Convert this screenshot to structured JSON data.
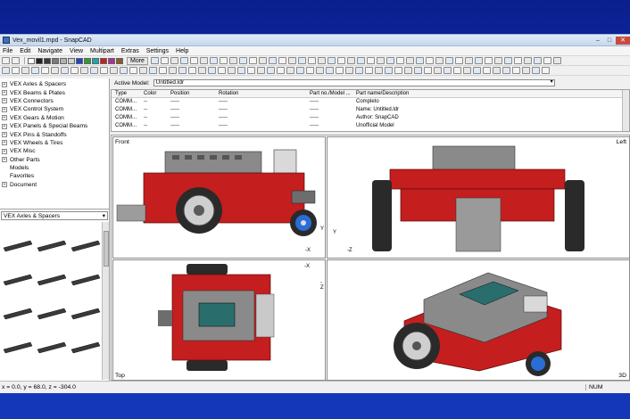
{
  "window": {
    "title": "Vex_movil1.mpd - SnapCAD",
    "minimize": "‒",
    "maximize": "□",
    "close": "✕"
  },
  "menu": [
    "File",
    "Edit",
    "Navigate",
    "View",
    "Multipart",
    "Extras",
    "Settings",
    "Help"
  ],
  "toolbar": {
    "more_label": "More",
    "swatch_colors": [
      "#ffffff",
      "#222222",
      "#3a3a3a",
      "#7a7a7a",
      "#b0b0b0",
      "#d0d0d0",
      "#1e44c8",
      "#2f9b34",
      "#1aa7b0",
      "#c8201e",
      "#b03090",
      "#8a5a2a"
    ]
  },
  "sidebar": {
    "tree": [
      {
        "label": "VEX Axles & Spacers",
        "expandable": true
      },
      {
        "label": "VEX Beams & Plates",
        "expandable": true
      },
      {
        "label": "VEX Connectors",
        "expandable": true
      },
      {
        "label": "VEX Control System",
        "expandable": true
      },
      {
        "label": "VEX Gears & Motion",
        "expandable": true
      },
      {
        "label": "VEX Panels & Special Beams",
        "expandable": true
      },
      {
        "label": "VEX Pins & Standoffs",
        "expandable": true
      },
      {
        "label": "VEX Wheels & Tires",
        "expandable": true
      },
      {
        "label": "VEX Misc",
        "expandable": true
      },
      {
        "label": "Other Parts",
        "expandable": true
      },
      {
        "label": "Models",
        "expandable": false
      },
      {
        "label": "Favorites",
        "expandable": false
      },
      {
        "label": "Document",
        "expandable": true
      }
    ],
    "category_select": "VEX Axles & Spacers"
  },
  "model": {
    "label": "Active Model:",
    "value": "Untitled.ldr"
  },
  "table": {
    "headers": [
      "Type",
      "Color",
      "Position",
      "Rotation",
      "Part no./Model ...",
      "Part name/Description"
    ],
    "rows": [
      [
        "COMM...",
        "--",
        "-----",
        "-----",
        "-----",
        "Completo"
      ],
      [
        "COMM...",
        "--",
        "-----",
        "-----",
        "-----",
        "Name: Untitled.ldr"
      ],
      [
        "COMM...",
        "--",
        "-----",
        "-----",
        "-----",
        "Author: SnapCAD"
      ],
      [
        "COMM...",
        "--",
        "-----",
        "-----",
        "-----",
        "Unofficial Model"
      ]
    ]
  },
  "viewports": {
    "front": "Front",
    "left": "Left",
    "top": "Top",
    "three_d": "3D",
    "axis_neg_x": "-X",
    "axis_neg_y": "-Y",
    "axis_pos_y": "Y",
    "axis_neg_z": "-Z"
  },
  "status": {
    "coords": "x = 0.0, y = 68.0, z = -304.0",
    "num": "NUM"
  },
  "colors": {
    "chassis_red": "#c41e1e",
    "metal_gray": "#8a8a8a",
    "tire_dark": "#2a2a2a",
    "accent_blue": "#2a6dd6"
  }
}
